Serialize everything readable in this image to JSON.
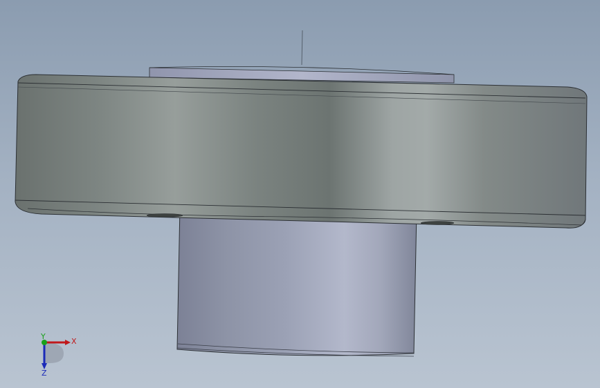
{
  "viewport": {
    "background_top": "#8b9cb0",
    "background_bottom": "#b9c4d1"
  },
  "model": {
    "flange_color": "#7c8480",
    "hub_color": "#9aa0b3",
    "edge_color": "#2b2f33"
  },
  "triad": {
    "x_label": "X",
    "y_label": "Y",
    "z_label": "Z",
    "x_color": "#c0181b",
    "y_color": "#1aa11a",
    "z_color": "#1b2ab8"
  }
}
